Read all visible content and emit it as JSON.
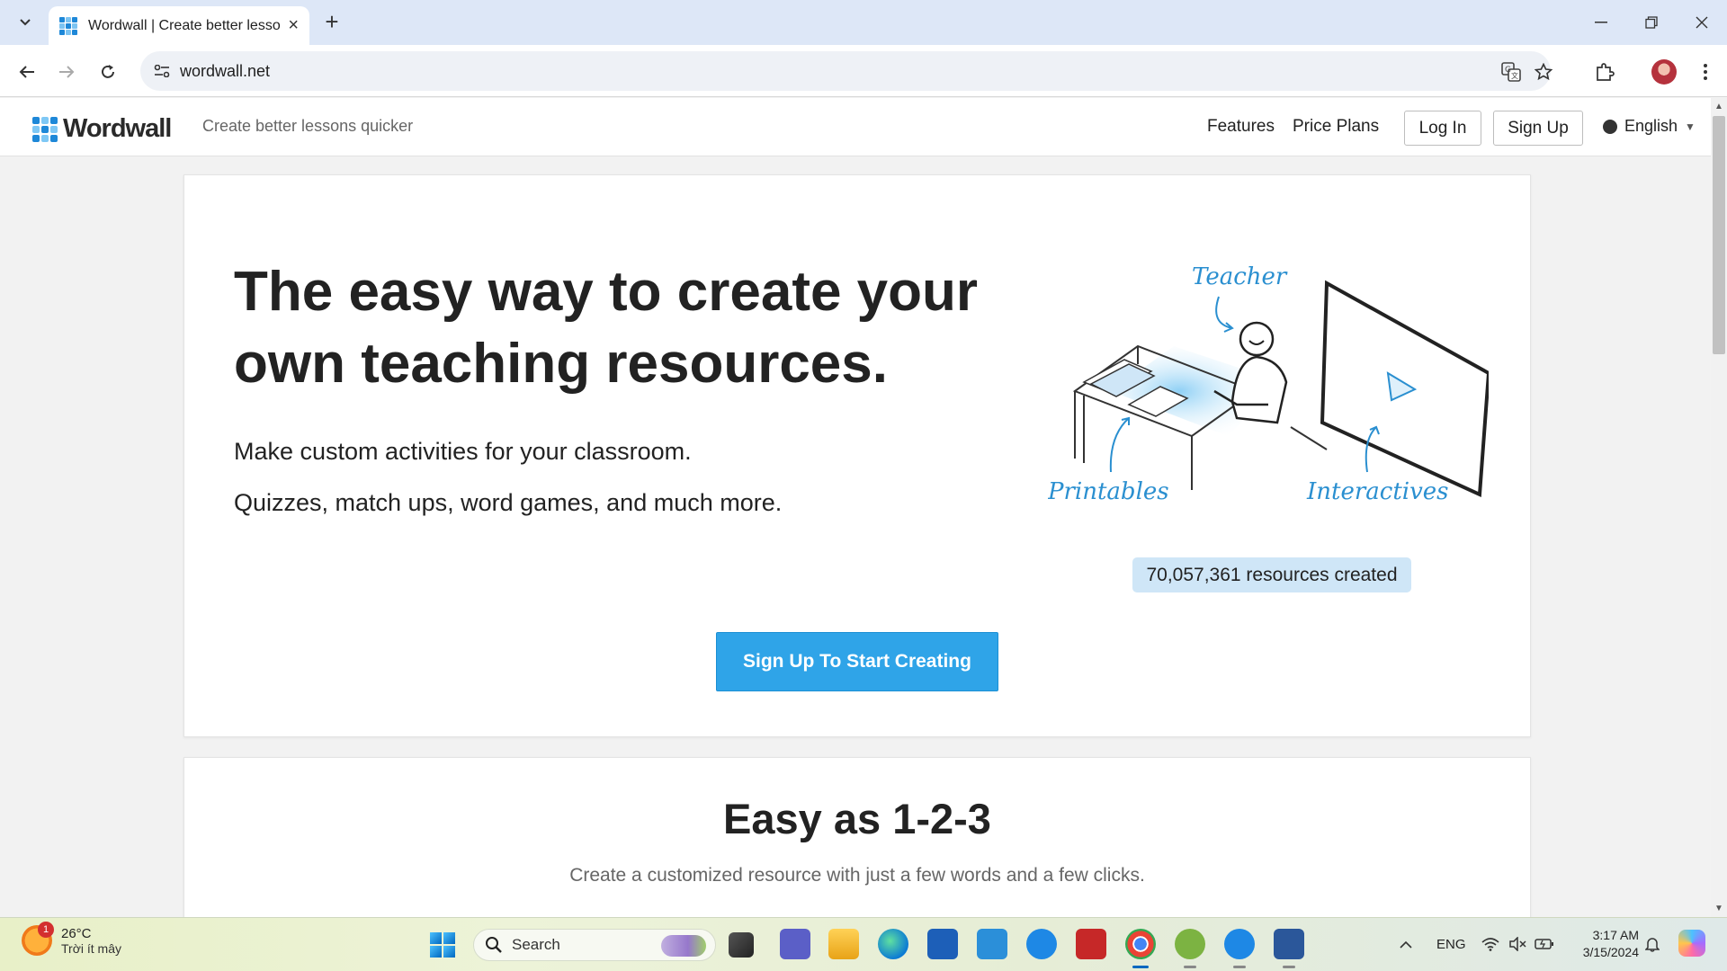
{
  "browser": {
    "tab_title": "Wordwall | Create better lesson",
    "url": "wordwall.net"
  },
  "site": {
    "logo_text": "Wordwall",
    "tagline": "Create better lessons quicker",
    "nav": {
      "features": "Features",
      "price_plans": "Price Plans",
      "log_in": "Log In",
      "sign_up": "Sign Up",
      "language": "English"
    }
  },
  "hero": {
    "title": "The easy way to create your own teaching resources.",
    "subtitle_1": "Make custom activities for your classroom.",
    "subtitle_2": "Quizzes, match ups, word games, and much more.",
    "illustration_labels": {
      "teacher": "Teacher",
      "printables": "Printables",
      "interactives": "Interactives"
    },
    "resource_count": "70,057,361 resources created",
    "cta_label": "Sign Up To Start Creating"
  },
  "steps_section": {
    "title": "Easy as 1-2-3",
    "subtitle": "Create a customized resource with just a few words and a few clicks."
  },
  "taskbar": {
    "weather_temp": "26°C",
    "weather_desc": "Trời ít mây",
    "weather_badge": "1",
    "search_placeholder": "Search",
    "language_indicator": "ENG",
    "time": "3:17 AM",
    "date": "3/15/2024"
  },
  "colors": {
    "brand_blue": "#2fa4e8",
    "badge_bg": "#cfe6f7",
    "tab_strip": "#dde7f7"
  }
}
